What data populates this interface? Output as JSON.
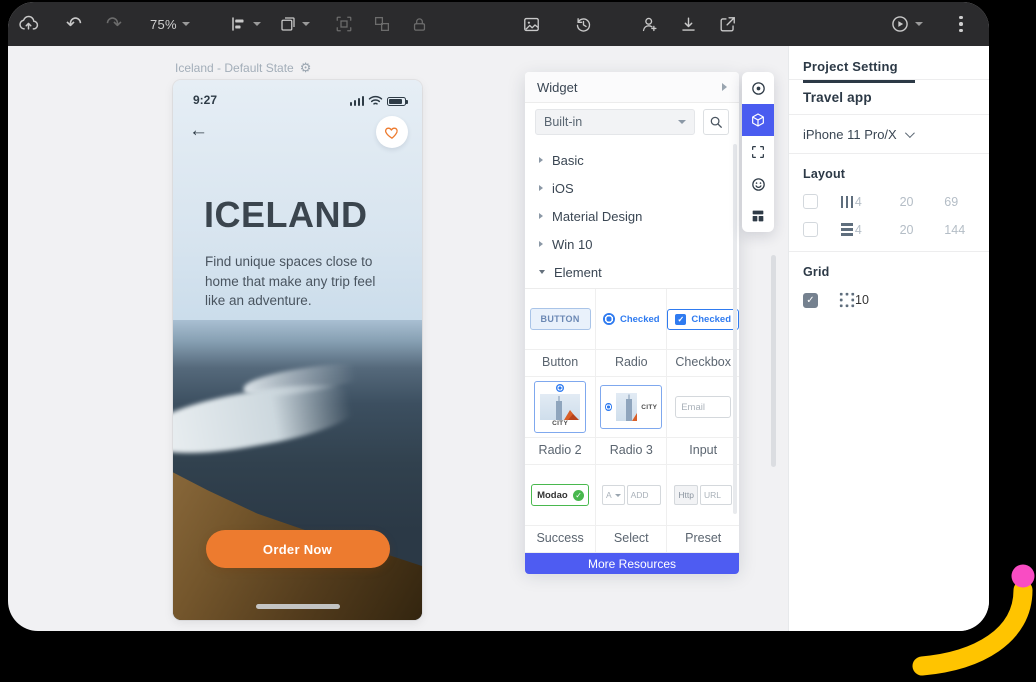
{
  "colors": {
    "accent_blue": "#4e5cf2",
    "widget_blue": "#2f7bf0",
    "cta_orange": "#ED7B2F",
    "success_green": "#49b84e",
    "decor_yellow": "#ffc400",
    "decor_pink": "#f94cc3",
    "toolbar_bg": "#2b2b2d"
  },
  "icons": {
    "undo": "↶",
    "redo": "↷",
    "back": "←",
    "gear": "⚙",
    "check": "✓"
  },
  "toolbar": {
    "zoom_level": "75%"
  },
  "canvas": {
    "artboard_title": "Iceland - Default State"
  },
  "phone": {
    "time": "9:27",
    "title": "ICELAND",
    "description": "Find unique spaces close to home that make any trip feel like an adventure.",
    "cta": "Order Now"
  },
  "widget_panel": {
    "title": "Widget",
    "library": "Built-in",
    "tree": [
      "Basic",
      "iOS",
      "Material Design",
      "Win 10",
      "Element"
    ],
    "grid": {
      "labels": [
        "Button",
        "Radio",
        "Checkbox",
        "Radio 2",
        "Radio 3",
        "Input",
        "Success",
        "Select",
        "Preset"
      ],
      "previews": {
        "button_label": "BUTTON",
        "radio_label": "Checked",
        "checkbox_label": "Checked",
        "radio2_caption": "CITY",
        "radio3_caption": "CITY",
        "input_placeholder": "Email",
        "success_value": "Modao",
        "select_letter": "A",
        "select_placeholder": "ADD",
        "preset_prefix": "Http",
        "preset_placeholder": "URL"
      }
    },
    "more": "More Resources"
  },
  "sidebar": {
    "tab": "Project Setting",
    "project": "Travel app",
    "device": "iPhone 11 Pro/X",
    "layout": {
      "title": "Layout",
      "rows": [
        {
          "checked": false,
          "values": [
            "4",
            "20",
            "69"
          ]
        },
        {
          "checked": false,
          "values": [
            "4",
            "20",
            "144"
          ]
        }
      ]
    },
    "grid": {
      "title": "Grid",
      "checked": true,
      "value": "10"
    }
  }
}
